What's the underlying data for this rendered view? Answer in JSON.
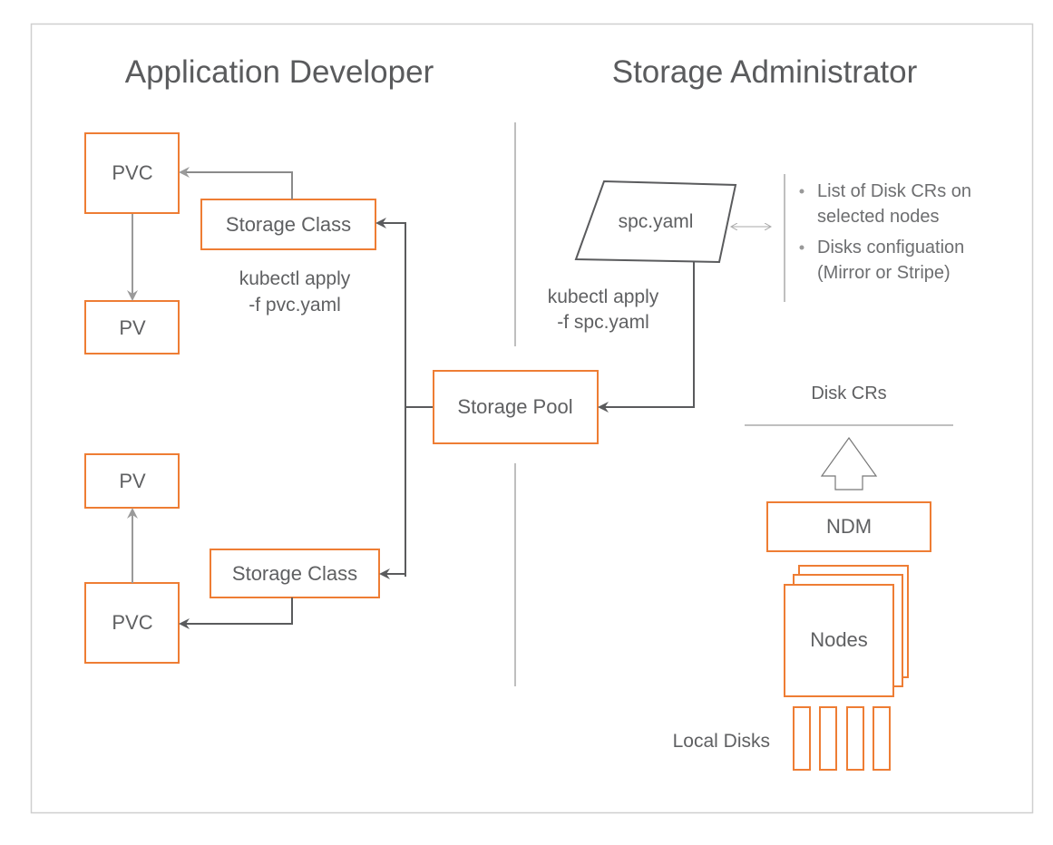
{
  "titles": {
    "left": "Application Developer",
    "right": "Storage Administrator"
  },
  "left_top": {
    "pvc": "PVC",
    "pv": "PV",
    "storage_class": "Storage Class",
    "cmd_line1": "kubectl apply",
    "cmd_line2": "-f pvc.yaml"
  },
  "left_bottom": {
    "pv": "PV",
    "pvc": "PVC",
    "storage_class": "Storage Class"
  },
  "center": {
    "storage_pool": "Storage Pool"
  },
  "right": {
    "spc_file": "spc.yaml",
    "cmd_line1": "kubectl apply",
    "cmd_line2": "-f spc.yaml",
    "notes": [
      {
        "line1": "List of Disk CRs on",
        "line2": "selected nodes"
      },
      {
        "line1": "Disks configuation",
        "line2": "(Mirror or Stripe)"
      }
    ],
    "disk_crs": "Disk CRs",
    "ndm": "NDM",
    "nodes": "Nodes",
    "local_disks": "Local Disks"
  },
  "colors": {
    "box_stroke": "#ee7d34",
    "text": "#5f6062",
    "connector": "#5a5b5d"
  }
}
